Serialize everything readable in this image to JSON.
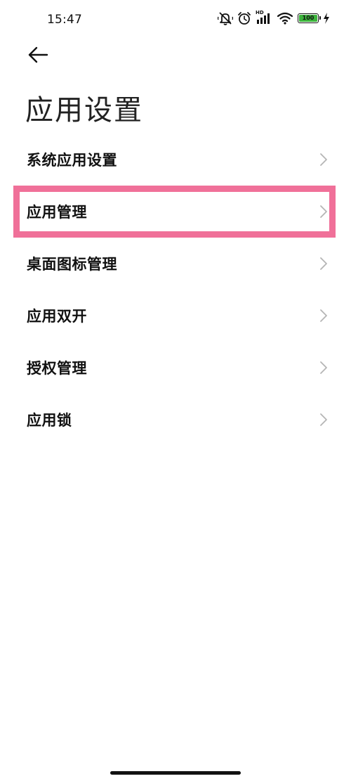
{
  "status_bar": {
    "time": "15:47",
    "network_label": "HD",
    "battery_level": "100",
    "icons": [
      "mute-vibrate-icon",
      "alarm-icon",
      "signal-icon",
      "wifi-icon",
      "battery-icon",
      "charging-icon"
    ]
  },
  "header": {
    "back_icon": "arrow-left-icon",
    "title": "应用设置"
  },
  "menu": {
    "items": [
      {
        "label": "系统应用设置",
        "highlighted": false
      },
      {
        "label": "应用管理",
        "highlighted": true
      },
      {
        "label": "桌面图标管理",
        "highlighted": false
      },
      {
        "label": "应用双开",
        "highlighted": false
      },
      {
        "label": "授权管理",
        "highlighted": false
      },
      {
        "label": "应用锁",
        "highlighted": false
      }
    ]
  },
  "colors": {
    "highlight_border": "#f07099",
    "battery_fill": "#3cb43c",
    "chevron": "#b5b5b5"
  }
}
